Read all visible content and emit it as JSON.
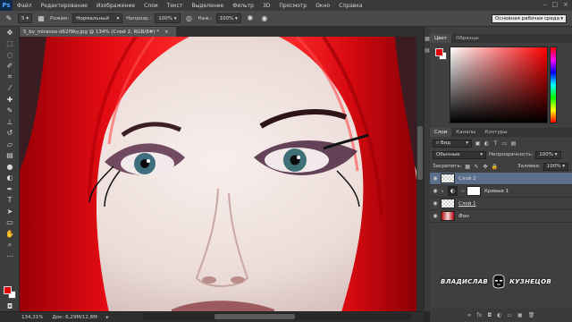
{
  "app": {
    "logo": "Ps",
    "menu": [
      "Файл",
      "Редактирование",
      "Изображение",
      "Слои",
      "Текст",
      "Выделение",
      "Фильтр",
      "3D",
      "Просмотр",
      "Окно",
      "Справка"
    ],
    "window_controls": [
      "–",
      "□",
      "×"
    ]
  },
  "options": {
    "brush_size": "5",
    "mode_label": "Режим:",
    "mode_value": "Нормальный",
    "opacity_label": "Непрозр.:",
    "opacity_value": "100%",
    "flow_label": "Наж.:",
    "flow_value": "100%",
    "workspace": "Основная рабочая среда"
  },
  "document": {
    "tab_title": "5_by_miranox-d62f9ky.jpg @ 134% (Слой 2, RGB/8#) *",
    "close": "×"
  },
  "status": {
    "zoom": "134,31%",
    "doc_size": "Док: 6,29M/12,8M"
  },
  "color_panel": {
    "tabs": [
      "Цвет",
      "Образцы"
    ],
    "foreground": "#e3000b",
    "background": "#ffffff"
  },
  "layers_panel": {
    "tabs": [
      "Слои",
      "Каналы",
      "Контуры"
    ],
    "filter_label": "Вид",
    "blend_mode": "Обычные",
    "opacity_label": "Непрозрачность:",
    "opacity_value": "100%",
    "lock_label": "Закрепить:",
    "fill_label": "Заливка:",
    "fill_value": "100%",
    "layers": [
      {
        "name": "Слой 2",
        "type": "pixel",
        "selected": true
      },
      {
        "name": "Кривые 1",
        "type": "adjustment",
        "selected": false
      },
      {
        "name": "Слой 1",
        "type": "pixel",
        "selected": false
      },
      {
        "name": "Фон",
        "type": "background",
        "selected": false
      }
    ]
  },
  "watermark": {
    "left": "ВЛАДИСЛАВ",
    "right": "КУЗНЕЦОВ"
  },
  "colors": {
    "accent_selected": "#5b6e8c",
    "hair": "#e3000b"
  }
}
